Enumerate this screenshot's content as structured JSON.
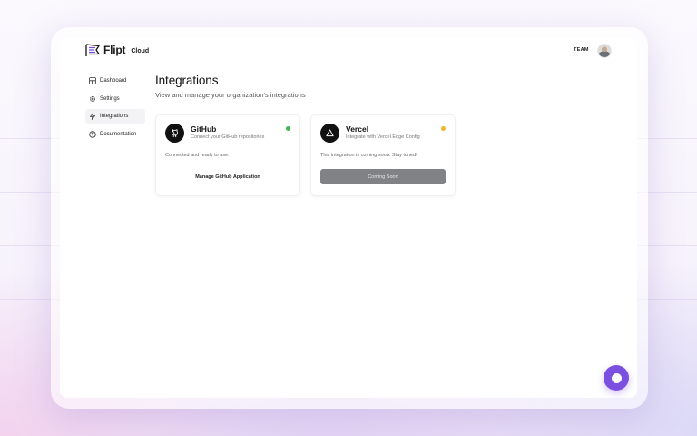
{
  "brand": {
    "name": "Flipt",
    "suffix": "Cloud",
    "accent_color": "#7b4fe0"
  },
  "header": {
    "org_name": "TEAM"
  },
  "sidebar": {
    "items": [
      {
        "label": "Dashboard",
        "icon": "dashboard-icon",
        "active": false
      },
      {
        "label": "Settings",
        "icon": "gear-icon",
        "active": false
      },
      {
        "label": "Integrations",
        "icon": "lightning-icon",
        "active": true
      },
      {
        "label": "Documentation",
        "icon": "help-circle-icon",
        "active": false
      }
    ]
  },
  "main": {
    "title": "Integrations",
    "subtitle": "View and manage your organization's integrations",
    "integrations": [
      {
        "name": "GitHub",
        "description": "Connect your GitHub repositories",
        "icon": "github-icon",
        "status_color": "#3fb950",
        "status_text": "Connected and ready to use.",
        "button_label": "Manage GitHub Application"
      },
      {
        "name": "Vercel",
        "description": "Integrate with Vercel Edge Config",
        "icon": "vercel-icon",
        "status_color": "#f0b429",
        "status_text": "This integration is coming soon. Stay tuned!",
        "button_label": "Coming Soon"
      }
    ]
  },
  "support_chat": {
    "icon": "chat-bubble-icon"
  }
}
